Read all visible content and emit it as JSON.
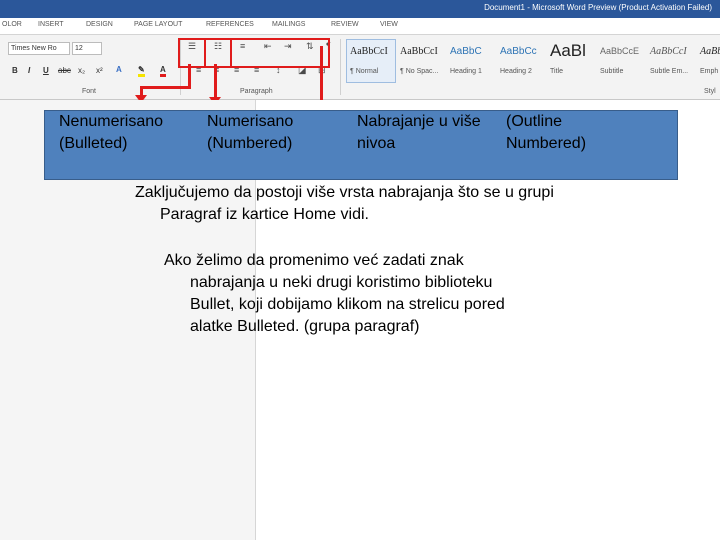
{
  "window": {
    "title": "Document1 - Microsoft Word Preview (Product Activation Failed)"
  },
  "tabs": [
    "OLOR",
    "INSERT",
    "DESIGN",
    "PAGE LAYOUT",
    "REFERENCES",
    "MAILINGS",
    "REVIEW",
    "VIEW"
  ],
  "ribbon": {
    "font_name": "Times New Ro",
    "font_size": "12",
    "font_group_label": "Font",
    "paragraph_group_label": "Paragraph",
    "styles_group_label": "Styl",
    "styles": [
      {
        "preview": "AaBbCcI",
        "name": "¶ Normal"
      },
      {
        "preview": "AaBbCcI",
        "name": "¶ No Spac..."
      },
      {
        "preview": "AaBbC",
        "name": "Heading 1"
      },
      {
        "preview": "AaBbCc",
        "name": "Heading 2"
      },
      {
        "preview": "AaBl",
        "name": "Title"
      },
      {
        "preview": "AaBbCcE",
        "name": "Subtitle"
      },
      {
        "preview": "AaBbCcI",
        "name": "Subtle Em..."
      },
      {
        "preview": "AaBbCcI",
        "name": "Emph"
      }
    ],
    "format_buttons": [
      "B",
      "I",
      "U",
      "abc",
      "x₂",
      "x²"
    ]
  },
  "labels": {
    "bulleted_line1": "Nenumerisano",
    "bulleted_line2": "(Bulleted)",
    "numbered_line1": "Numerisano",
    "numbered_line2": "(Numbered)",
    "multilevel_line1": "Nabrajanje u više",
    "multilevel_line2": "nivoa",
    "outline_line1": "(Outline",
    "outline_line2": "Numbered)"
  },
  "body": {
    "p1_line1": "Zaključujemo da postoji više vrsta nabrajanja što se u grupi",
    "p1_line2": "Paragraf iz  kartice  Home vidi.",
    "p2_line1": "Ako želimo da promenimo  već zadati znak",
    "p2_line2": "nabrajanja u neki drugi koristimo biblioteku",
    "p2_line3": "Bullet, koji dobijamo klikom na strelicu pored",
    "p2_line4": "alatke Bulleted. (grupa paragraf)"
  },
  "colors": {
    "accent_red": "#e01b1b",
    "box_blue": "#4f81bd",
    "word_blue": "#2b579a"
  }
}
